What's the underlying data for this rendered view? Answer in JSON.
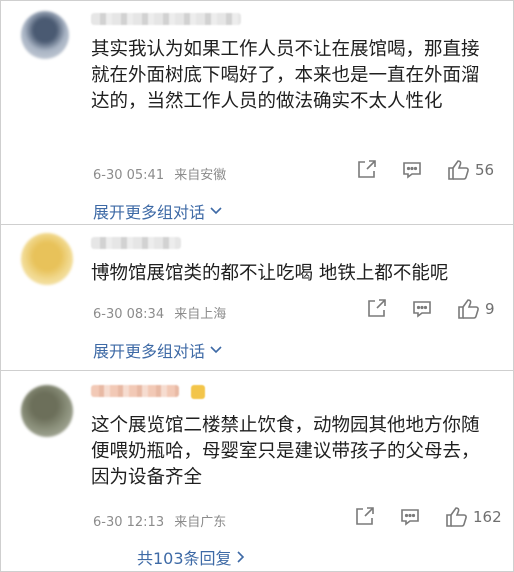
{
  "comments": [
    {
      "text": "其实我认为如果工作人员不让在展馆喝，那直接就在外面树底下喝好了，本来也是一直在外面溜达的，当然工作人员的做法确实不太人性化",
      "date": "6-30 05:41",
      "location": "来自安徽",
      "likes": "56",
      "more_label": "展开更多组对话",
      "more_icon": "chevron-down"
    },
    {
      "text": "博物馆展馆类的都不让吃喝 地铁上都不能呢",
      "date": "6-30 08:34",
      "location": "来自上海",
      "likes": "9",
      "more_label": "展开更多组对话",
      "more_icon": "chevron-down"
    },
    {
      "text": "这个展览馆二楼禁止饮食，动物园其他地方你随便喂奶瓶哈，母婴室只是建议带孩子的父母去，因为设备齐全",
      "date": "6-30 12:13",
      "location": "来自广东",
      "likes": "162",
      "more_label": "共103条回复",
      "more_icon": "chevron-right"
    }
  ],
  "icons": {
    "share": "share-icon",
    "comment": "comment-icon",
    "like": "thumbs-up-icon"
  },
  "colors": {
    "link": "#3e6aa6",
    "meta": "#8c8c8c",
    "border": "#cfcfcf"
  }
}
